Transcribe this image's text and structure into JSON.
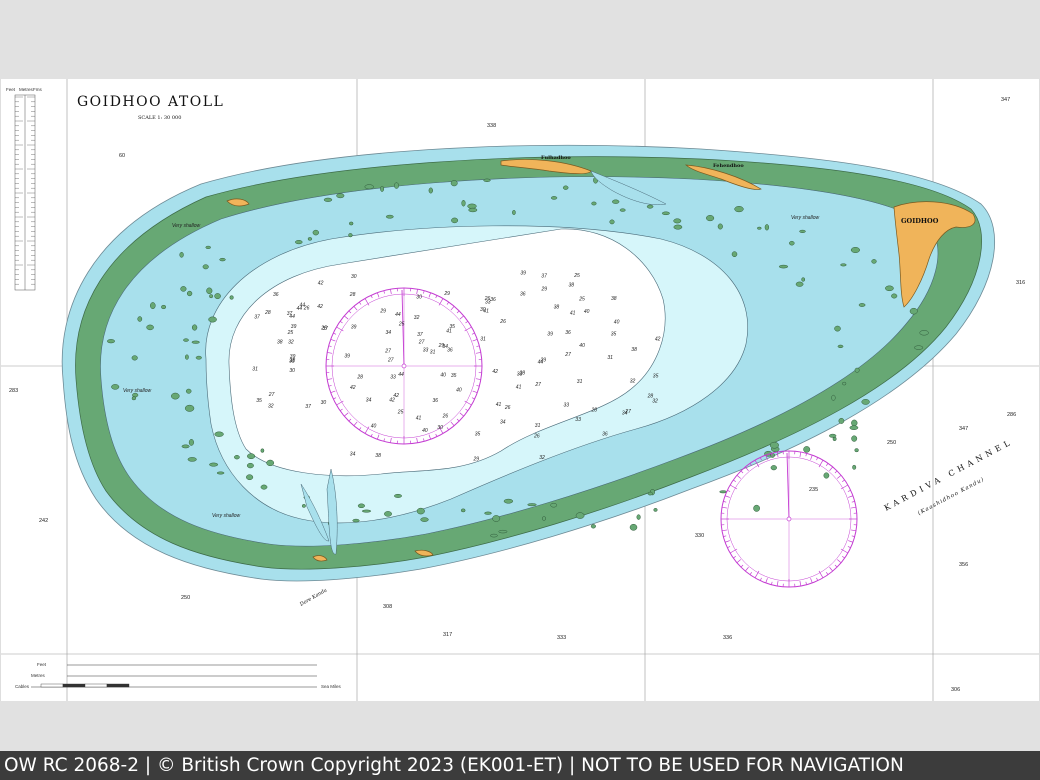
{
  "chart": {
    "title": "GOIDHOO ATOLL",
    "scale": "SCALE 1: 30 000",
    "channel_label": "KARDIVA CHANNEL",
    "channel_sub": "(Kaashidhoo Kandu)",
    "features": {
      "goidhoo": "GOIDHOO",
      "fulhadhoo": "Fulhadhoo",
      "fehendhoo": "Fehendhoo",
      "dore_kandu": "Dore Kandu",
      "very_shallow_1": "Very shallow",
      "very_shallow_2": "Very shallow",
      "very_shallow_3": "Very shallow",
      "shallow_ne": "Very shallow"
    },
    "scale_bar": {
      "feet": "Feet",
      "metres": "Metres",
      "cables": "Cables",
      "sea_miles": "Sea Miles"
    },
    "depth_scale_headers": [
      "Feet",
      "Metres",
      "Fms"
    ],
    "depths": [
      "27",
      "31",
      "40",
      "36",
      "42",
      "38",
      "37",
      "33",
      "35",
      "44",
      "39",
      "34",
      "41",
      "32",
      "29",
      "30",
      "28",
      "26",
      "25"
    ],
    "margin_soundings": [
      "338",
      "60",
      "283",
      "242",
      "250",
      "316",
      "347",
      "356",
      "286",
      "250",
      "330",
      "336",
      "306",
      "317",
      "333",
      "347",
      "308",
      "235"
    ]
  },
  "colors": {
    "land": "#f0b45a",
    "reef": "#67a874",
    "shallow": "#a8e0ec",
    "lagoon": "#d6f6fa",
    "deep_lagoon": "#ffffff",
    "compass": "#c43cd2",
    "contour": "#4a6a78"
  },
  "footer": {
    "text": "OW RC 2068-2 | © British Crown Copyright 2023 (EK001-ET) | NOT TO BE USED FOR NAVIGATION"
  }
}
